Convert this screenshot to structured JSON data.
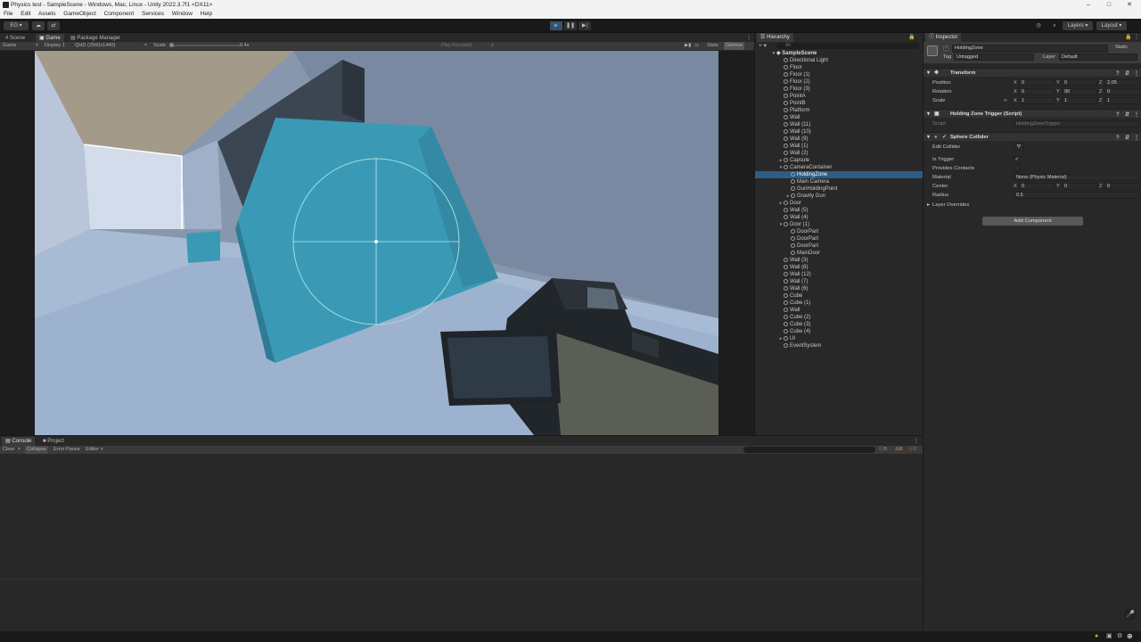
{
  "window": {
    "title": "Physics test - SampleScene - Windows, Mac, Linux - Unity 2022.3.7f1 <DX11>",
    "minimize": "–",
    "maximize": "□",
    "close": "✕"
  },
  "menu": [
    "File",
    "Edit",
    "Assets",
    "GameObject",
    "Component",
    "Services",
    "Window",
    "Help"
  ],
  "toolbar": {
    "account": "EG ▾",
    "layers": "Layers",
    "layout": "Layout",
    "play": "▶",
    "pause": "❚❚",
    "step": "▶|"
  },
  "scene_tabs": {
    "scene": "Scene",
    "game": "Game",
    "package_manager": "Package Manager",
    "more": "⋮"
  },
  "game_bar": {
    "mode": "Game",
    "display": "Display 1",
    "resolution": "QHD (2560x1440)",
    "scale_label": "Scale",
    "scale_value": "0.4x",
    "play_focused": "Play Focused",
    "stats": "Stats",
    "gizmos": "Gizmos"
  },
  "hierarchy": {
    "tab": "Hierarchy",
    "search_placeholder": "All",
    "scene": "SampleScene",
    "items": [
      {
        "label": "Directional Light",
        "depth": 1
      },
      {
        "label": "Floor",
        "depth": 1
      },
      {
        "label": "Floor (1)",
        "depth": 1
      },
      {
        "label": "Floor (2)",
        "depth": 1
      },
      {
        "label": "Floor (3)",
        "depth": 1
      },
      {
        "label": "PointA",
        "depth": 1
      },
      {
        "label": "PointB",
        "depth": 1
      },
      {
        "label": "Platform",
        "depth": 1
      },
      {
        "label": "Wall",
        "depth": 1
      },
      {
        "label": "Wall (11)",
        "depth": 1
      },
      {
        "label": "Wall (10)",
        "depth": 1
      },
      {
        "label": "Wall (9)",
        "depth": 1
      },
      {
        "label": "Wall (1)",
        "depth": 1
      },
      {
        "label": "Wall (2)",
        "depth": 1
      },
      {
        "label": "Capsule",
        "depth": 1,
        "fold": "▸"
      },
      {
        "label": "CameraContainer",
        "depth": 1,
        "fold": "▾"
      },
      {
        "label": "HoldingZone",
        "depth": 2,
        "selected": true
      },
      {
        "label": "Main Camera",
        "depth": 2
      },
      {
        "label": "GunHoldingPoint",
        "depth": 2
      },
      {
        "label": "Gravity Gun",
        "depth": 2,
        "fold": "▸"
      },
      {
        "label": "Door",
        "depth": 1,
        "fold": "▸"
      },
      {
        "label": "Wall (5)",
        "depth": 1
      },
      {
        "label": "Wall (4)",
        "depth": 1
      },
      {
        "label": "Door (1)",
        "depth": 1,
        "fold": "▾"
      },
      {
        "label": "DoorPart",
        "depth": 2
      },
      {
        "label": "DoorPart",
        "depth": 2
      },
      {
        "label": "DoorPart",
        "depth": 2
      },
      {
        "label": "MainDoor",
        "depth": 2
      },
      {
        "label": "Wall (3)",
        "depth": 1
      },
      {
        "label": "Wall (8)",
        "depth": 1
      },
      {
        "label": "Wall (12)",
        "depth": 1
      },
      {
        "label": "Wall (7)",
        "depth": 1
      },
      {
        "label": "Wall (6)",
        "depth": 1
      },
      {
        "label": "Cube",
        "depth": 1
      },
      {
        "label": "Cube (1)",
        "depth": 1
      },
      {
        "label": "Wall",
        "depth": 1
      },
      {
        "label": "Cube (2)",
        "depth": 1
      },
      {
        "label": "Cube (3)",
        "depth": 1
      },
      {
        "label": "Cube (4)",
        "depth": 1
      },
      {
        "label": "UI",
        "depth": 1,
        "fold": "▸"
      },
      {
        "label": "EventSystem",
        "depth": 1
      }
    ]
  },
  "inspector": {
    "tab": "Inspector",
    "object_name": "HoldingZone",
    "static": "Static",
    "tag_label": "Tag",
    "tag_value": "Untagged",
    "layer_label": "Layer",
    "layer_value": "Default",
    "transform": {
      "header": "Transform",
      "position_label": "Position",
      "rotation_label": "Rotation",
      "scale_label": "Scale",
      "position": [
        "0",
        "0",
        "2.05"
      ],
      "rotation": [
        "0",
        "90",
        "0"
      ],
      "scale": [
        "1",
        "1",
        "1"
      ]
    },
    "script_comp": {
      "header": "Holding Zone Trigger (Script)",
      "script_label": "Script",
      "script_value": "HoldingZoneTrigger"
    },
    "collider": {
      "header": "Sphere Collider",
      "edit_collider": "Edit Collider",
      "is_trigger": "Is Trigger",
      "provides_contacts": "Provides Contacts",
      "material_label": "Material",
      "material_value": "None (Physic Material)",
      "center_label": "Center",
      "center": [
        "0",
        "0",
        "0"
      ],
      "radius_label": "Radius",
      "radius": "0.5"
    },
    "layer_overrides": "Layer Overrides",
    "add_component": "Add Component"
  },
  "console": {
    "console_tab": "Console",
    "project_tab": "Project",
    "clear": "Clear",
    "collapse": "Collapse",
    "error_pause": "Error Pause",
    "editor": "Editor",
    "count_info": "0",
    "count_warn": "0",
    "count_err": "0"
  },
  "axes": {
    "x": "X",
    "y": "Y",
    "z": "Z"
  },
  "colors": {
    "accent": "#2c5d87",
    "cube": "#3a9ab6",
    "play_active": "#4aa3e8"
  }
}
